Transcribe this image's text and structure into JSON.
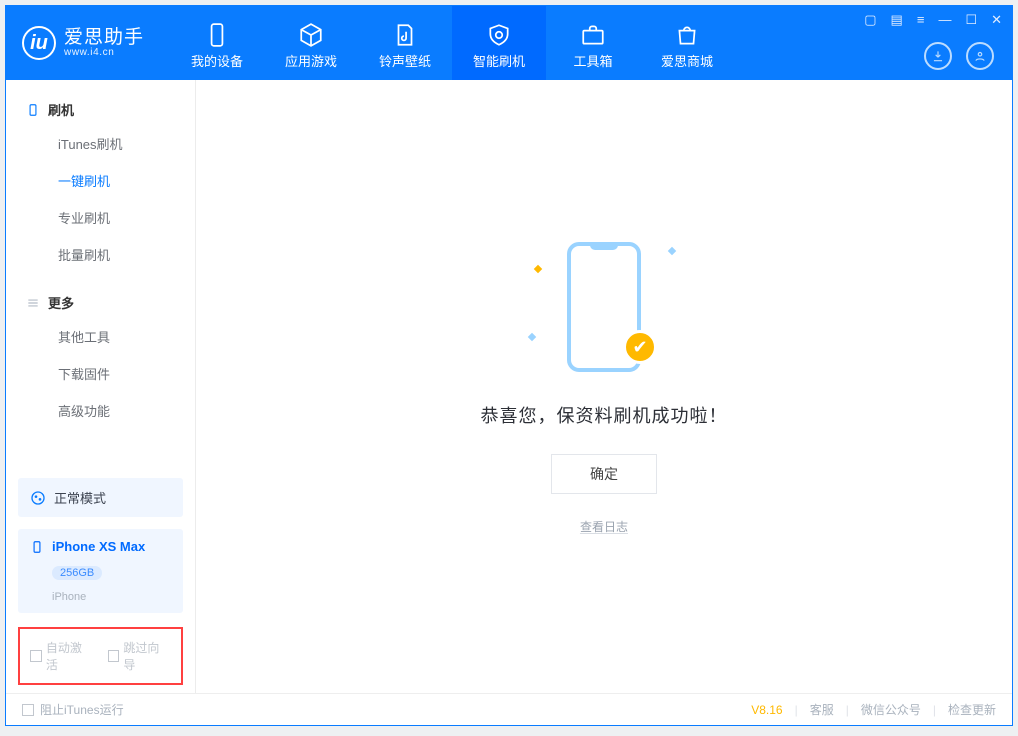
{
  "brand": {
    "title": "爱思助手",
    "subtitle": "www.i4.cn"
  },
  "tabs": {
    "device": "我的设备",
    "apps": "应用游戏",
    "ringtones": "铃声壁纸",
    "flash": "智能刷机",
    "toolbox": "工具箱",
    "store": "爱思商城"
  },
  "sidebar": {
    "group_flash": "刷机",
    "items_flash": {
      "itunes": "iTunes刷机",
      "onekey": "一键刷机",
      "pro": "专业刷机",
      "batch": "批量刷机"
    },
    "group_more": "更多",
    "items_more": {
      "other": "其他工具",
      "firmware": "下载固件",
      "advanced": "高级功能"
    },
    "mode_label": "正常模式",
    "device_name": "iPhone XS Max",
    "device_capacity": "256GB",
    "device_type": "iPhone",
    "opt_auto_activate": "自动激活",
    "opt_skip_guide": "跳过向导"
  },
  "main": {
    "success_text": "恭喜您，保资料刷机成功啦！",
    "ok_btn": "确定",
    "view_log": "查看日志"
  },
  "footer": {
    "block_itunes": "阻止iTunes运行",
    "version": "V8.16",
    "support": "客服",
    "wechat": "微信公众号",
    "update": "检查更新"
  }
}
